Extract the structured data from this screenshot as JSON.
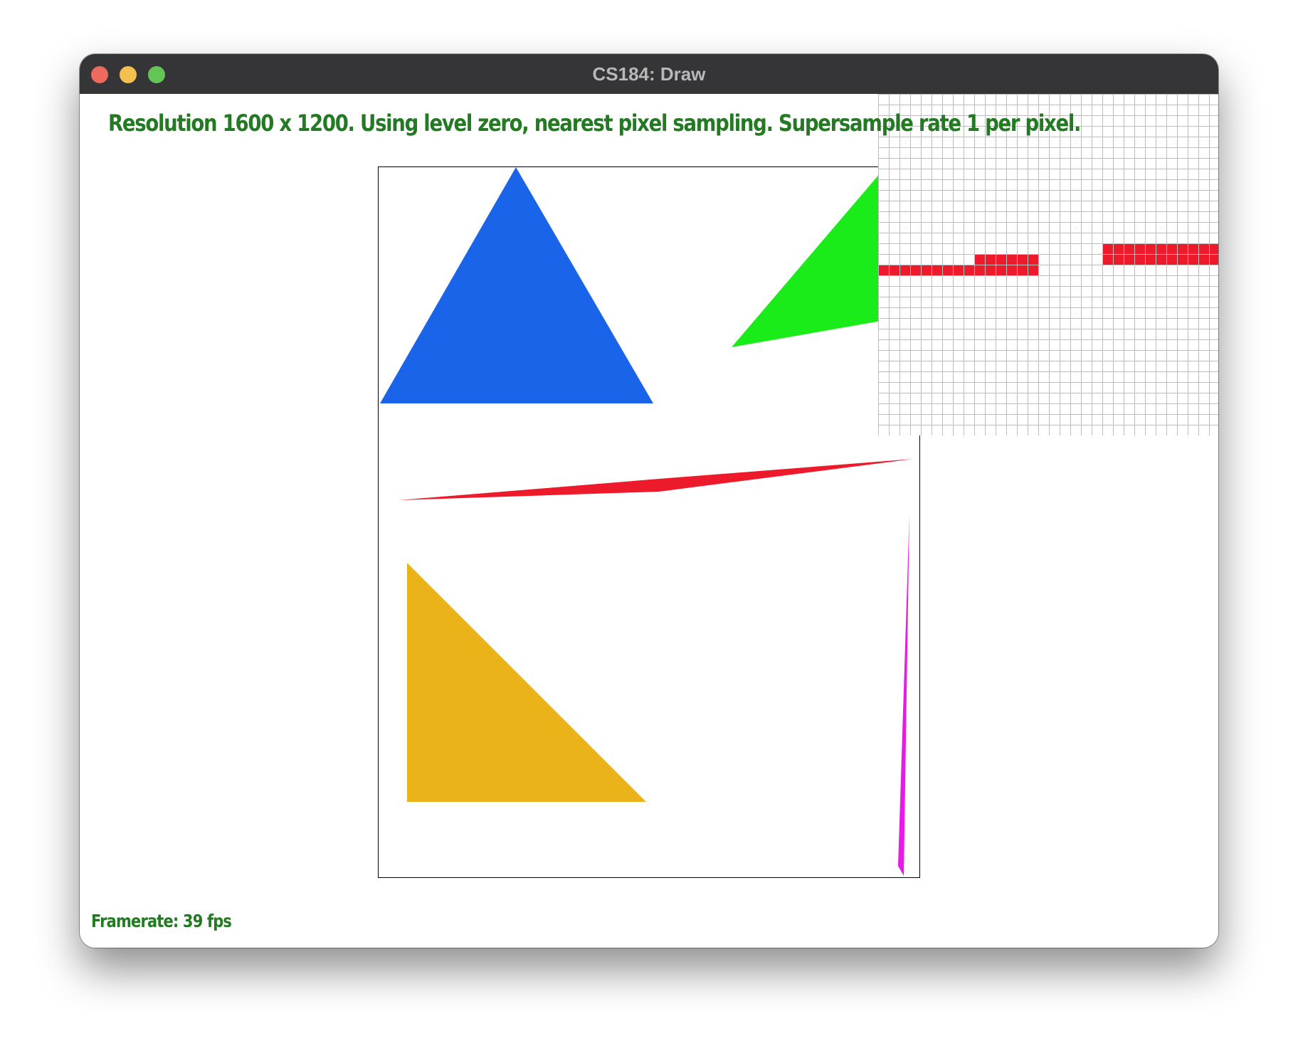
{
  "window": {
    "title": "CS184: Draw"
  },
  "status": {
    "text": "Resolution 1600 x 1200. Using level zero, nearest pixel sampling. Supersample rate 1 per pixel.",
    "framerate": "Framerate: 39 fps"
  },
  "colors": {
    "status_text": "#237a23",
    "blue_triangle": "#1a64ea",
    "green_triangle": "#1aec1a",
    "red_sliver": "#ec1a2a",
    "yellow_triangle": "#ebb31a",
    "magenta_sliver": "#e81ae8",
    "zoom_grid": "#bdbdbd"
  }
}
